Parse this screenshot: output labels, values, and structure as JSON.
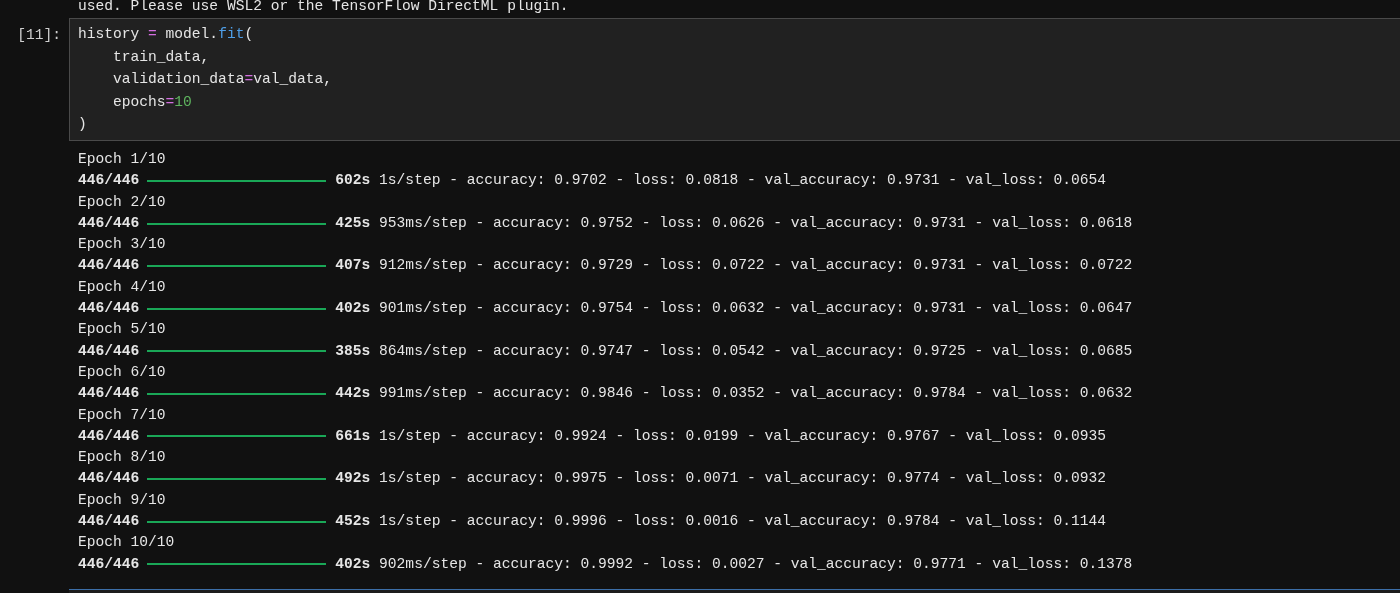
{
  "warning_text": "used. Please use WSL2 or the TensorFlow DirectML plugin.",
  "cell": {
    "prompt": "[11]:",
    "code_lines": [
      [
        {
          "text": "history ",
          "kind": "name"
        },
        {
          "text": "=",
          "kind": "op"
        },
        {
          "text": " model.",
          "kind": "name"
        },
        {
          "text": "fit",
          "kind": "func"
        },
        {
          "text": "(",
          "kind": "name"
        }
      ],
      [
        {
          "text": "    train_data,",
          "kind": "name"
        }
      ],
      [
        {
          "text": "    validation_data",
          "kind": "name"
        },
        {
          "text": "=",
          "kind": "op"
        },
        {
          "text": "val_data,",
          "kind": "name"
        }
      ],
      [
        {
          "text": "    epochs",
          "kind": "name"
        },
        {
          "text": "=",
          "kind": "op"
        },
        {
          "text": "10",
          "kind": "number"
        }
      ],
      [
        {
          "text": ")",
          "kind": "name"
        }
      ]
    ]
  },
  "output": [
    {
      "epoch": "Epoch 1/10",
      "steps": "446/446",
      "level": 1,
      "time": "602s",
      "metrics": "1s/step - accuracy: 0.9702 - loss: 0.0818 - val_accuracy: 0.9731 - val_loss: 0.0654"
    },
    {
      "epoch": "Epoch 2/10",
      "steps": "446/446",
      "level": 1,
      "time": "425s",
      "metrics": "953ms/step - accuracy: 0.9752 - loss: 0.0626 - val_accuracy: 0.9731 - val_loss: 0.0618"
    },
    {
      "epoch": "Epoch 3/10",
      "steps": "446/446",
      "level": 1,
      "time": "407s",
      "metrics": "912ms/step - accuracy: 0.9729 - loss: 0.0722 - val_accuracy: 0.9731 - val_loss: 0.0722"
    },
    {
      "epoch": "Epoch 4/10",
      "steps": "446/446",
      "level": 1,
      "time": "402s",
      "metrics": "901ms/step - accuracy: 0.9754 - loss: 0.0632 - val_accuracy: 0.9731 - val_loss: 0.0647"
    },
    {
      "epoch": "Epoch 5/10",
      "steps": "446/446",
      "level": 1,
      "time": "385s",
      "metrics": "864ms/step - accuracy: 0.9747 - loss: 0.0542 - val_accuracy: 0.9725 - val_loss: 0.0685"
    },
    {
      "epoch": "Epoch 6/10",
      "steps": "446/446",
      "level": 1,
      "time": "442s",
      "metrics": "991ms/step - accuracy: 0.9846 - loss: 0.0352 - val_accuracy: 0.9784 - val_loss: 0.0632"
    },
    {
      "epoch": "Epoch 7/10",
      "steps": "446/446",
      "level": 1,
      "time": "661s",
      "metrics": "1s/step - accuracy: 0.9924 - loss: 0.0199 - val_accuracy: 0.9767 - val_loss: 0.0935"
    },
    {
      "epoch": "Epoch 8/10",
      "steps": "446/446",
      "level": 1,
      "time": "492s",
      "metrics": "1s/step - accuracy: 0.9975 - loss: 0.0071 - val_accuracy: 0.9774 - val_loss: 0.0932"
    },
    {
      "epoch": "Epoch 9/10",
      "steps": "446/446",
      "level": 1,
      "time": "452s",
      "metrics": "1s/step - accuracy: 0.9996 - loss: 0.0016 - val_accuracy: 0.9784 - val_loss: 0.1144"
    },
    {
      "epoch": "Epoch 10/10",
      "steps": "446/446",
      "level": 1,
      "time": "402s",
      "metrics": "902ms/step - accuracy: 0.9992 - loss: 0.0027 - val_accuracy: 0.9771 - val_loss: 0.1378"
    }
  ]
}
